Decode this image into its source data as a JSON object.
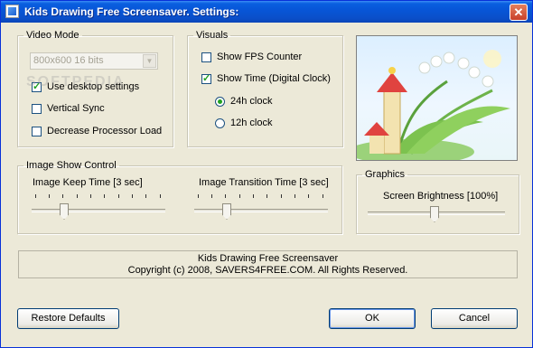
{
  "window": {
    "title": "Kids Drawing Free Screensaver. Settings:",
    "close_glyph": "✕"
  },
  "video_mode": {
    "legend": "Video Mode",
    "resolution_value": "800x600 16 bits",
    "use_desktop_settings": {
      "label": "Use desktop settings",
      "checked": true
    },
    "vertical_sync": {
      "label": "Vertical Sync",
      "checked": false
    },
    "decrease_load": {
      "label": "Decrease Processor Load",
      "checked": false
    }
  },
  "visuals": {
    "legend": "Visuals",
    "show_fps": {
      "label": "Show FPS Counter",
      "checked": false
    },
    "show_time": {
      "label": "Show Time (Digital Clock)",
      "checked": true
    },
    "clock_24h": {
      "label": "24h clock",
      "selected": true
    },
    "clock_12h": {
      "label": "12h clock",
      "selected": false
    }
  },
  "image_show": {
    "legend": "Image Show Control",
    "keep_time_label": "Image Keep Time [3 sec]",
    "keep_time_value": 3,
    "transition_label": "Image Transition Time [3 sec]",
    "transition_value": 3
  },
  "graphics": {
    "legend": "Graphics",
    "brightness_label": "Screen Brightness [100%]",
    "brightness_value": 100
  },
  "info": {
    "line1": "Kids Drawing Free Screensaver",
    "line2": "Copyright (c) 2008, SAVERS4FREE.COM. All Rights Reserved."
  },
  "buttons": {
    "restore": "Restore Defaults",
    "ok": "OK",
    "cancel": "Cancel"
  },
  "watermark": "SOFTPEDIA",
  "colors": {
    "titlebar": "#0a5fe0",
    "check_mark": "#21a121",
    "dialog_bg": "#ece9d8"
  }
}
